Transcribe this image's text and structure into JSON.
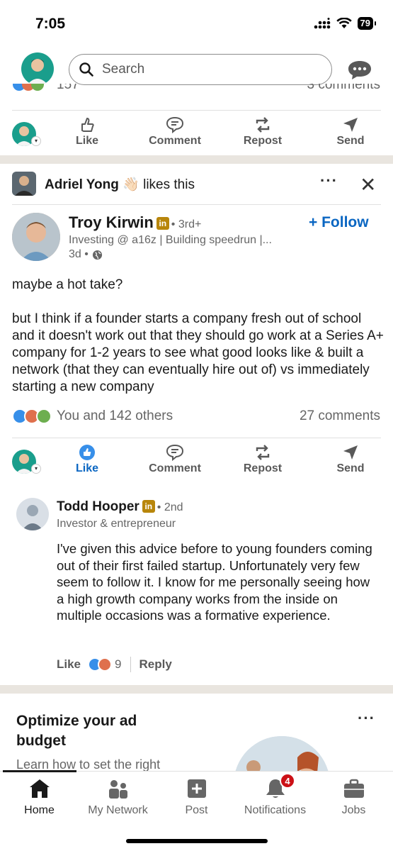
{
  "status_bar": {
    "time": "7:05",
    "battery": "79"
  },
  "top_bar": {
    "search_placeholder": "Search"
  },
  "partial_card": {
    "count": "157",
    "comments": "3 comments"
  },
  "action_bar": {
    "like": "Like",
    "comment": "Comment",
    "repost": "Repost",
    "send": "Send"
  },
  "social_line": {
    "name": "Adriel Yong",
    "emoji": "👋🏻",
    "text": "likes this"
  },
  "post": {
    "author_name": "Troy Kirwin",
    "badge": "in",
    "degree": "• 3rd+",
    "headline": "Investing @ a16z | Building speedrun |...",
    "time": "3d •",
    "follow": "+ Follow",
    "text": "maybe a hot take?\n\nbut I think if a founder starts a company fresh out of school and it doesn't work out that they should go work at a Series A+ company for 1-2 years to see what good looks like & built a network (that they can eventually hire out of) vs immediately starting a new company",
    "reactions_text": "You and 142 others",
    "comments_text": "27 comments"
  },
  "comment": {
    "name": "Todd Hooper",
    "badge": "in",
    "degree": "• 2nd",
    "headline": "Investor & entrepreneur",
    "text": "I've given this advice before to young founders coming out of their first failed startup. Unfortunately very few seem to follow it. I know for me personally seeing how a high growth company works from the inside on multiple occasions was a formative experience.",
    "like": "Like",
    "reaction_count": "9",
    "reply": "Reply"
  },
  "ad": {
    "title": "Optimize your ad budget",
    "subtitle": "Learn how to set the right"
  },
  "bottom_nav": {
    "home": "Home",
    "network": "My Network",
    "post": "Post",
    "notifications": "Notifications",
    "notifications_badge": "4",
    "jobs": "Jobs"
  },
  "colors": {
    "accent": "#0a66c2",
    "badge_red": "#cc1016",
    "band": "#e9e5df"
  }
}
